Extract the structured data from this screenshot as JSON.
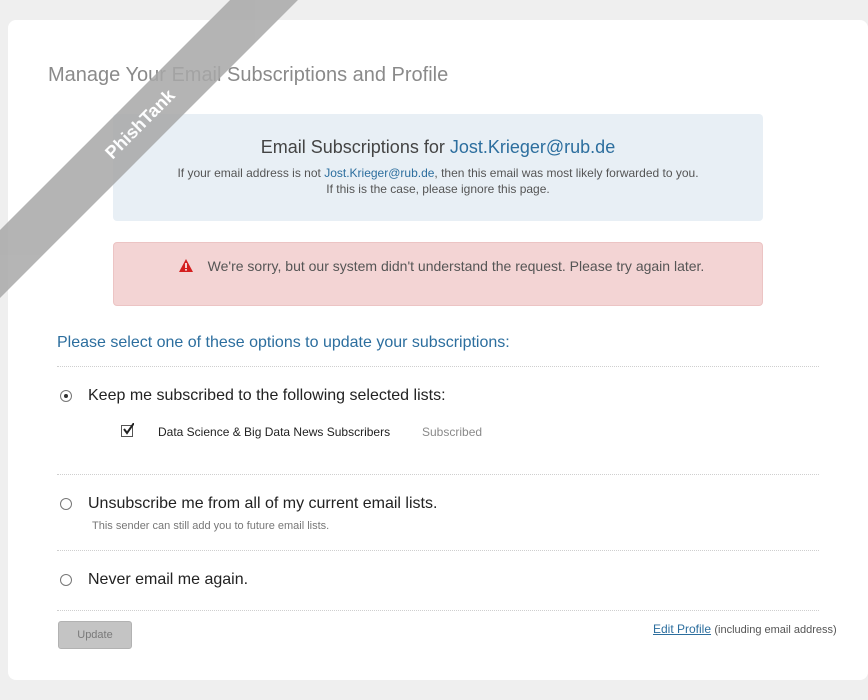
{
  "page": {
    "title": "Manage Your Email Subscriptions and Profile"
  },
  "info": {
    "title_prefix": "Email Subscriptions for",
    "email": "Jost.Krieger@rub.de",
    "line1_prefix": "If your email address is not",
    "line1_suffix": ", then this email was most likely forwarded to you.",
    "line2": "If this is the case, please ignore this page."
  },
  "error": {
    "icon": "warning-icon",
    "message": "We're sorry, but our system didn't understand the request. Please try again later.",
    "color": "#f3d4d4"
  },
  "options": {
    "prompt": "Please select one of these options to update your subscriptions:",
    "keep": {
      "label": "Keep me subscribed to the following selected lists:",
      "selected": true,
      "lists": [
        {
          "name": "Data Science & Big Data News Subscribers",
          "status": "Subscribed",
          "checked": true
        }
      ]
    },
    "unsubscribe": {
      "label": "Unsubscribe me from all of my current email lists.",
      "note": "This sender can still add you to future email lists.",
      "selected": false
    },
    "never": {
      "label": "Never email me again.",
      "selected": false
    }
  },
  "footer": {
    "update_label": "Update",
    "edit_profile_label": "Edit Profile",
    "edit_profile_hint": "(including email address)"
  },
  "watermark": {
    "banner_text": "PhishTank"
  },
  "colors": {
    "accent": "#2c6e9e",
    "info_bg": "#e8eff5",
    "error_bg": "#f3d4d4",
    "button_bg": "#c4c4c4"
  }
}
